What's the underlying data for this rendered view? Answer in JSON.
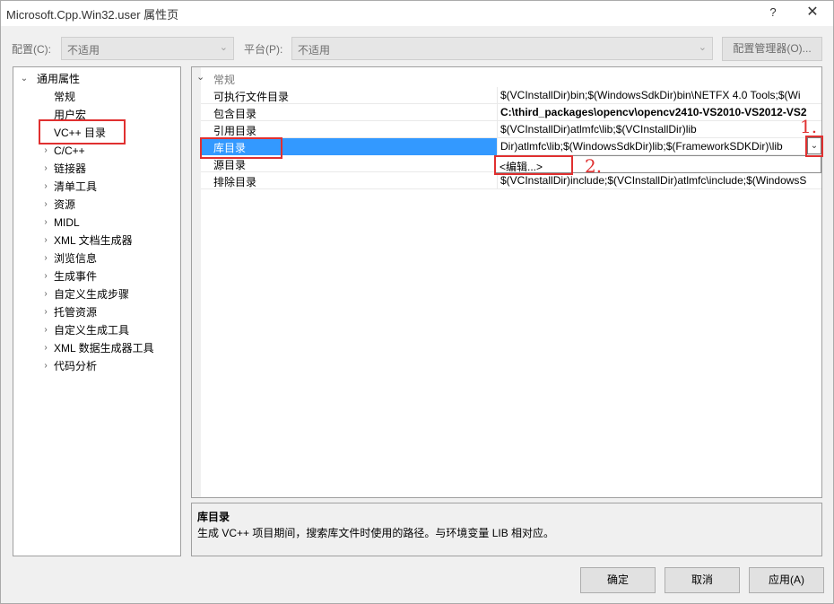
{
  "window": {
    "title": "Microsoft.Cpp.Win32.user 属性页",
    "help": "?",
    "close": "✕"
  },
  "config": {
    "configuration_label": "配置(C):",
    "configuration_value": "不适用",
    "platform_label": "平台(P):",
    "platform_value": "不适用",
    "manager_button": "配置管理器(O)..."
  },
  "tree": {
    "root": "通用属性",
    "items": [
      {
        "label": "常规"
      },
      {
        "label": "用户宏"
      },
      {
        "label": "VC++ 目录"
      },
      {
        "label": "C/C++"
      },
      {
        "label": "链接器"
      },
      {
        "label": "清单工具"
      },
      {
        "label": "资源"
      },
      {
        "label": "MIDL"
      },
      {
        "label": "XML 文档生成器"
      },
      {
        "label": "浏览信息"
      },
      {
        "label": "生成事件"
      },
      {
        "label": "自定义生成步骤"
      },
      {
        "label": "托管资源"
      },
      {
        "label": "自定义生成工具"
      },
      {
        "label": "XML 数据生成器工具"
      },
      {
        "label": "代码分析"
      }
    ]
  },
  "grid": {
    "category": "常规",
    "rows": [
      {
        "name": "可执行文件目录",
        "value": "$(VCInstallDir)bin;$(WindowsSdkDir)bin\\NETFX 4.0 Tools;$(Wi"
      },
      {
        "name": "包含目录",
        "value": "C:\\third_packages\\opencv\\opencv2410-VS2010-VS2012-VS2"
      },
      {
        "name": "引用目录",
        "value": "$(VCInstallDir)atlmfc\\lib;$(VCInstallDir)lib"
      },
      {
        "name": "库目录",
        "value": "Dir)atlmfc\\lib;$(WindowsSdkDir)lib;$(FrameworkSDKDir)\\lib"
      },
      {
        "name": "源目录",
        "value": ""
      },
      {
        "name": "排除目录",
        "value": "$(VCInstallDir)include;$(VCInstallDir)atlmfc\\include;$(WindowsS"
      }
    ],
    "dropdown_option": "<编辑...>"
  },
  "annotations": {
    "one": "1.",
    "two": "2."
  },
  "description": {
    "title": "库目录",
    "text": "生成 VC++ 项目期间，搜索库文件时使用的路径。与环境变量 LIB 相对应。"
  },
  "buttons": {
    "ok": "确定",
    "cancel": "取消",
    "apply": "应用(A)"
  },
  "colors": {
    "selection": "#3399ff",
    "annotation_red": "#e03030"
  }
}
